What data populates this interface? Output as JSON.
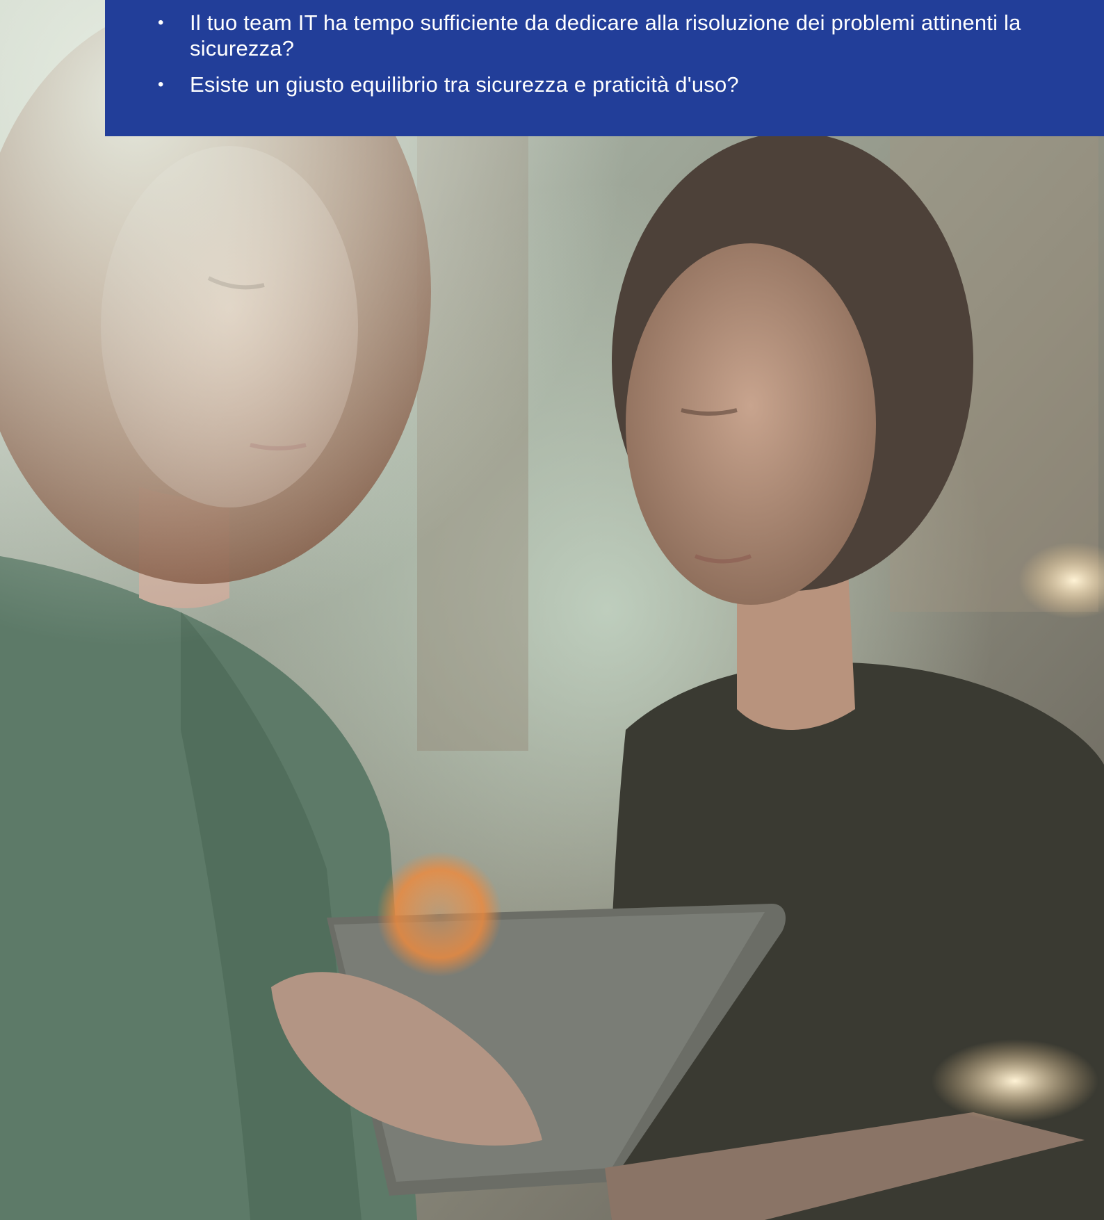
{
  "photo": {
    "description_icon": "two-women-looking-at-tablet-photo-icon"
  },
  "banner": {
    "bullets": [
      {
        "marker": "•",
        "text": "Il tuo team IT ha tempo sufficiente da dedicare alla risoluzione dei problemi attinenti la sicurezza?"
      },
      {
        "marker": "•",
        "text": "Esiste un giusto equilibrio tra sicurezza e praticità d'uso?"
      }
    ],
    "background_color": "#223e99"
  }
}
